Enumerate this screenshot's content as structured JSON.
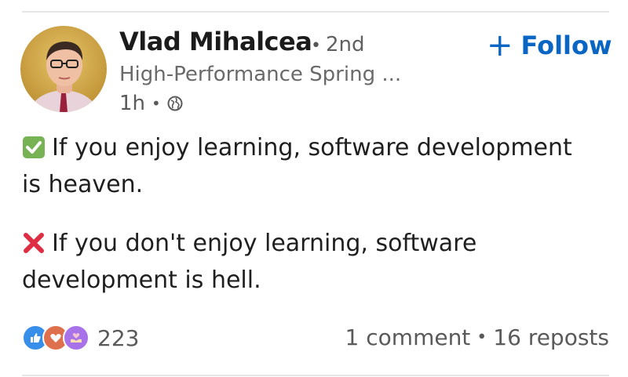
{
  "author": {
    "name": "Vlad Mihalcea",
    "connection_degree": "2nd",
    "headline": "High-Performance Spring ...",
    "posted_time": "1h",
    "visibility_icon": "globe-icon"
  },
  "follow_button": {
    "icon": "plus-icon",
    "label": "Follow"
  },
  "post": {
    "paragraph_1": {
      "emoji": "check-mark-icon",
      "text": "If you enjoy learning, software development is heaven."
    },
    "paragraph_2": {
      "emoji": "cross-mark-icon",
      "text": "If you don't enjoy learning, software development is hell."
    }
  },
  "social": {
    "reaction_icons": [
      "like-icon",
      "love-icon",
      "support-icon"
    ],
    "reaction_count": "223",
    "comments": "1 comment",
    "reposts": "16 reposts"
  },
  "colors": {
    "brand_blue": "#0a66c2",
    "check_green": "#77b255",
    "cross_red": "#dd2e44",
    "like_blue": "#378fe9",
    "love_red": "#df704d",
    "support_purple": "#a872e8",
    "text_primary": "#1f1f1f",
    "text_secondary": "#5a5a5a"
  }
}
